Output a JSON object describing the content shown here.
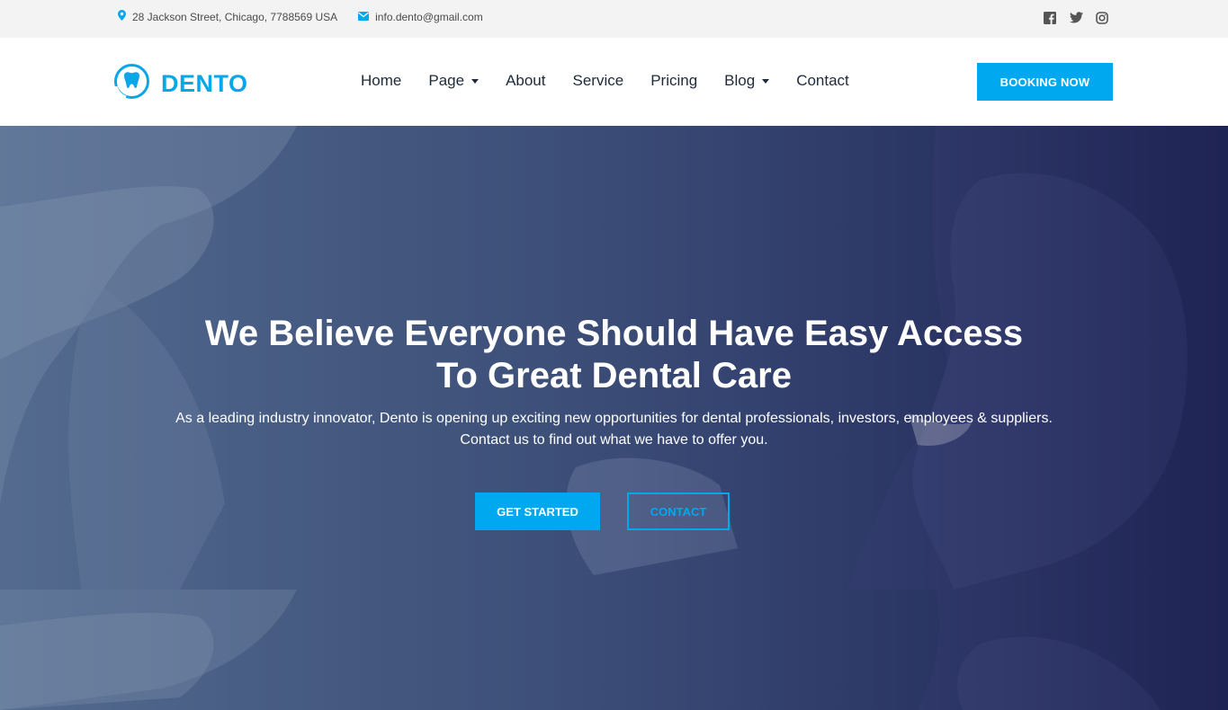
{
  "topbar": {
    "address": "28 Jackson Street, Chicago, 7788569 USA",
    "email": "info.dento@gmail.com",
    "social_icons": [
      "facebook-icon",
      "twitter-icon",
      "instagram-icon"
    ]
  },
  "header": {
    "logo_text": "DENTO",
    "nav": [
      {
        "label": "Home",
        "dropdown": false
      },
      {
        "label": "Page",
        "dropdown": true
      },
      {
        "label": "About",
        "dropdown": false
      },
      {
        "label": "Service",
        "dropdown": false
      },
      {
        "label": "Pricing",
        "dropdown": false
      },
      {
        "label": "Blog",
        "dropdown": true
      },
      {
        "label": "Contact",
        "dropdown": false
      }
    ],
    "booking_label": "BOOKING NOW"
  },
  "hero": {
    "title_line1": "We Believe Everyone Should Have Easy Access",
    "title_line2": "To Great Dental Care",
    "desc_line1": "As a leading industry innovator, Dento is opening up exciting new opportunities for dental professionals, investors, employees & suppliers.",
    "desc_line2": "Contact us to find out what we have to offer you.",
    "primary_label": "GET STARTED",
    "secondary_label": "CONTACT"
  },
  "colors": {
    "accent": "#00a8ef",
    "topbar_bg": "#f3f3f3",
    "hero_overlay": "#2b3566"
  }
}
